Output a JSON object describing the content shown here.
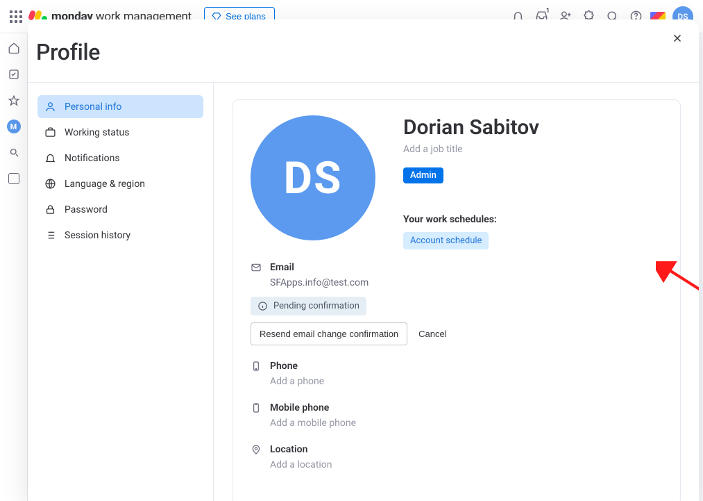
{
  "topbar": {
    "brand_bold": "monday",
    "brand_light": " work management",
    "see_plans": "See plans",
    "inbox_badge": "1",
    "avatar_initials": "DS"
  },
  "leftrail": {
    "m_label": "M"
  },
  "modal": {
    "title": "Profile"
  },
  "nav": {
    "personal_info": "Personal info",
    "working_status": "Working status",
    "notifications": "Notifications",
    "language_region": "Language & region",
    "password": "Password",
    "session_history": "Session history"
  },
  "profile": {
    "avatar_initials": "DS",
    "name": "Dorian Sabitov",
    "job_placeholder": "Add a job title",
    "role": "Admin",
    "schedules_title": "Your work schedules:",
    "schedule_pill": "Account schedule"
  },
  "email": {
    "label": "Email",
    "value": "SFApps.info@test.com",
    "pending": "Pending confirmation",
    "resend": "Resend email change confirmation",
    "cancel": "Cancel"
  },
  "phone": {
    "label": "Phone",
    "placeholder": "Add a phone"
  },
  "mobile": {
    "label": "Mobile phone",
    "placeholder": "Add a mobile phone"
  },
  "location": {
    "label": "Location",
    "placeholder": "Add a location"
  }
}
